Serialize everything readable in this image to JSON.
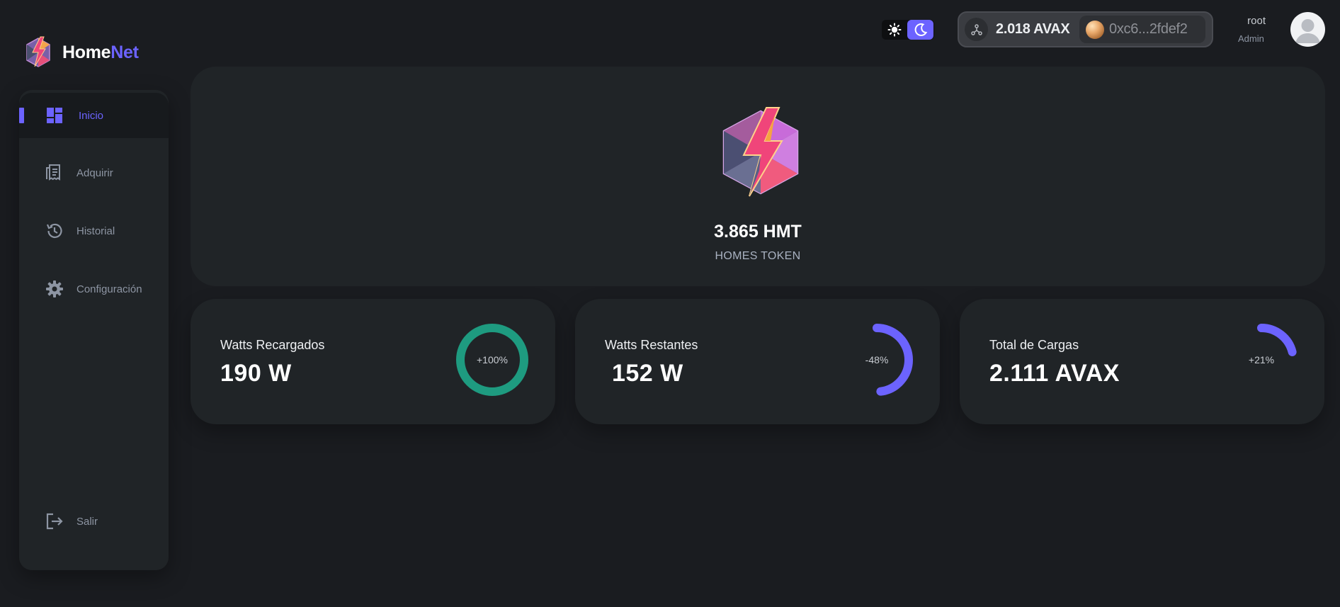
{
  "brand": {
    "part1": "Home",
    "part2": "Net"
  },
  "sidebar": {
    "items": [
      {
        "label": "Inicio",
        "icon": "dashboard-icon",
        "active": true
      },
      {
        "label": "Adquirir",
        "icon": "receipt-icon"
      },
      {
        "label": "Historial",
        "icon": "history-icon"
      },
      {
        "label": "Configuración",
        "icon": "gear-icon"
      }
    ],
    "logout": {
      "label": "Salir",
      "icon": "logout-icon"
    }
  },
  "header": {
    "theme": {
      "light_icon": "sun-icon",
      "dark_icon": "moon-icon",
      "selected": "dark"
    },
    "wallet": {
      "balance": "2.018 AVAX",
      "address": "0xc6...2fdef2",
      "network_icon": "network-icon"
    },
    "user": {
      "name": "root",
      "role": "Admin"
    }
  },
  "token": {
    "amount": "3.865 HMT",
    "name": "HOMES TOKEN"
  },
  "stats": [
    {
      "label": "Watts Recargados",
      "value": "190 W",
      "percent_label": "+100%",
      "progress": 1.0,
      "color": "#1e9b80"
    },
    {
      "label": "Watts Restantes",
      "value": " 152 W",
      "percent_label": "-48%",
      "progress": 0.48,
      "color": "#6c63ff"
    },
    {
      "label": "Total de Cargas",
      "value": "2.111 AVAX",
      "percent_label": "+21%",
      "progress": 0.21,
      "color": "#6c63ff"
    }
  ],
  "colors": {
    "accent": "#6c63ff",
    "teal": "#1e9b80",
    "card": "#202427",
    "background": "#1a1c20"
  }
}
